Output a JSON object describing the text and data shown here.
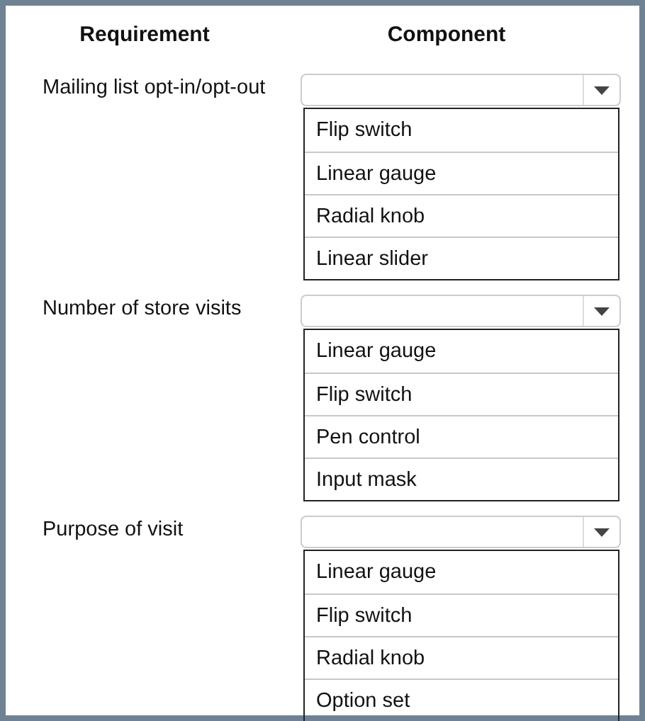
{
  "columns": [
    "Requirement",
    "Component"
  ],
  "rows": [
    {
      "requirement": "Mailing list opt-in/opt-out",
      "options": [
        "Flip switch",
        "Linear gauge",
        "Radial knob",
        "Linear slider"
      ]
    },
    {
      "requirement": "Number of store visits",
      "options": [
        "Linear gauge",
        "Flip switch",
        "Pen control",
        "Input mask"
      ]
    },
    {
      "requirement": "Purpose of visit",
      "options": [
        "Linear gauge",
        "Flip switch",
        "Radial knob",
        "Option set"
      ]
    }
  ]
}
